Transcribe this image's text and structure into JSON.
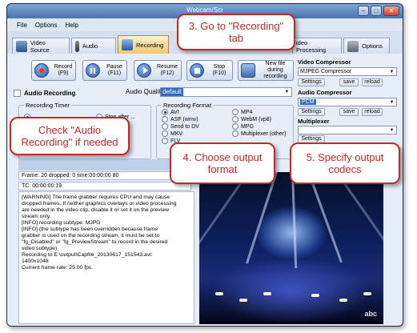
{
  "window": {
    "title": "Webcam/Scr"
  },
  "menu": [
    "File",
    "Options",
    "Help"
  ],
  "tabs": [
    {
      "label": "Video Source"
    },
    {
      "label": "Audio"
    },
    {
      "label": "Recording"
    },
    {
      "label": "ideo Processing"
    },
    {
      "label": "Options"
    }
  ],
  "controls": {
    "record": {
      "label": "Record",
      "key": "(F9)"
    },
    "pause": {
      "label": "Pause",
      "key": "(F11)"
    },
    "resume": {
      "label": "Resume",
      "key": "(F12)"
    },
    "stop": {
      "label": "Stop",
      "key": "(F10)"
    },
    "newfile": {
      "label": "New file during",
      "label2": "recording"
    }
  },
  "audio_recording": {
    "label": "Audio Recording",
    "quality_label": "Audio Quality:",
    "quality_value": "default"
  },
  "recording_timer": {
    "title": "Recording Timer",
    "stop_after": "Stop after ..."
  },
  "recording_format": {
    "title": "Recording Format",
    "left": [
      "AVI",
      "ASF (wmv)",
      "Send to DV",
      "MKV",
      "FLV"
    ],
    "right": [
      "MP4",
      "WebM (vp8)",
      "MPG",
      "Multiplexer (other)"
    ],
    "selected": "AVI"
  },
  "video_compressor": {
    "label": "Video Compressor",
    "value": "MJPEG Compressor"
  },
  "audio_compressor": {
    "label": "Audio Compressor",
    "value": "PCM"
  },
  "multiplexer": {
    "label": "Multiplexer",
    "value": ""
  },
  "buttons": {
    "settings": "Settings",
    "save": "save",
    "reload": "reload"
  },
  "status": {
    "frame": "Frame: 20 dropped: 0 time:00:00:00 80",
    "tc": "TC: 00:00:00:19"
  },
  "log": [
    "[WARNING] The frame grabber requires CPU and may cause",
    "dropped frames. If neither graphics overlays or video processing",
    "are needed in the video clip, disable it or set it on the preview",
    "stream only.",
    "[INFO] recording subtype: MJPG",
    "[INFO] (the subtype has been overridden because frame",
    "grabber is used on the recording stream, it must be set to",
    "\"fg_Disabled\" or \"fg_PreviewStream\" to record in the desired",
    "video subtype)",
    "Recording to E:\\output\\Capfile_20130617_151543.avi:",
    "1400x1048",
    "Current frame rate: 25.00 fps."
  ],
  "video": {
    "watermark": "abc"
  },
  "callouts": {
    "c1": [
      "3. Go to \"Recording\"",
      "tab"
    ],
    "c2": [
      "Check \"Audio",
      "Recording\" if needed"
    ],
    "c3": [
      "4. Choose output",
      "format"
    ],
    "c4": [
      "5. Specify output",
      "codecs"
    ]
  },
  "colors": {
    "callout": "#c62828",
    "window_frame": "#2e4b7a",
    "active_tab": "#f2c86c"
  }
}
